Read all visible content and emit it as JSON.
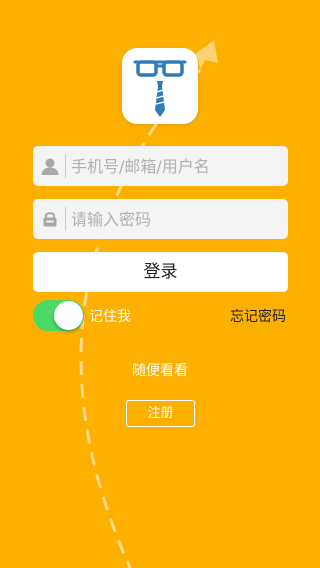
{
  "login_form": {
    "username_placeholder": "手机号/邮箱/用户名",
    "username_value": "",
    "password_placeholder": "请输入密码",
    "password_value": "",
    "login_label": "登录"
  },
  "options": {
    "remember_me_label": "记住我",
    "remember_me_on": true,
    "forgot_password_label": "忘记密码"
  },
  "browse_label": "随便看看",
  "register_label": "注册",
  "colors": {
    "background": "#FDB000",
    "toggle_on": "#4CD964",
    "logo_blue": "#2F7DB8"
  },
  "icons": {
    "logo": "glasses-tie-logo",
    "username_field": "user-icon",
    "password_field": "lock-icon"
  }
}
